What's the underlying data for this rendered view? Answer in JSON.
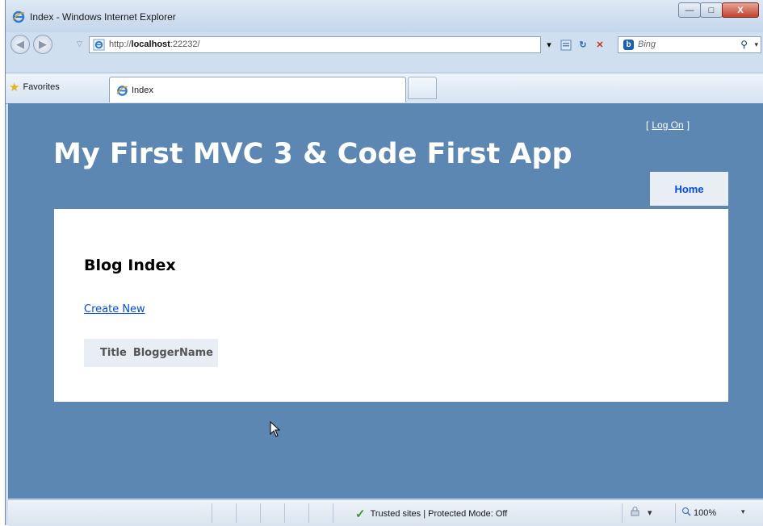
{
  "window": {
    "title": "Index - Windows Internet Explorer",
    "minimize_glyph": "—",
    "maximize_glyph": "□",
    "close_glyph": "X"
  },
  "address_bar": {
    "url_prefix": "http://",
    "url_host": "localhost",
    "url_suffix": ":22232/",
    "dropdown_glyph": "▾",
    "compat_icon": "compatibility-view-icon",
    "refresh_glyph": "↻",
    "stop_glyph": "✕"
  },
  "search": {
    "logo": "b",
    "placeholder": "Bing",
    "go_glyph": "⚲",
    "dropdown_glyph": "▾"
  },
  "favorites_bar": {
    "favorites_label": "Favorites",
    "tab_label": "Index"
  },
  "page": {
    "login_open": "[",
    "login_link": "Log On",
    "login_close": "]",
    "site_title": "My First MVC 3 & Code First App",
    "menu_home": "Home",
    "heading": "Blog Index",
    "create_link": "Create New",
    "table_columns": [
      "Title",
      "BloggerName"
    ]
  },
  "status_bar": {
    "zone_text": "Trusted sites | Protected Mode: Off",
    "zoom": "100%",
    "zoom_dropdown": "▾",
    "tools_dropdown": "▾"
  },
  "colors": {
    "page_background": "#5c87b2",
    "main_background": "#ffffff",
    "link": "#034af3",
    "menu_tab": "#e8eef4"
  }
}
